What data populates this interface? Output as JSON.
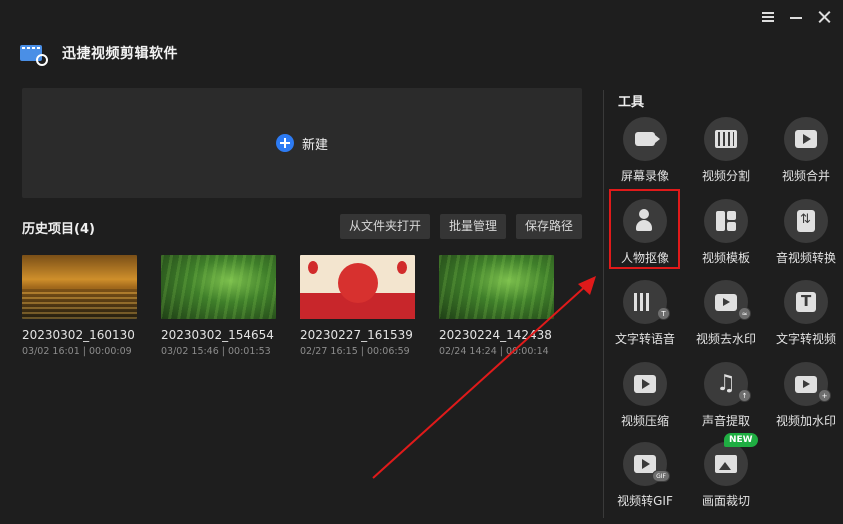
{
  "window": {
    "menu_icon": "hamburger-menu-icon",
    "minimize_icon": "minimize-icon",
    "close_icon": "close-icon"
  },
  "app": {
    "title": "迅捷视频剪辑软件",
    "logo_icon": "film-scissors-logo",
    "accent_color": "#2d7bf3"
  },
  "new_project": {
    "label": "新建",
    "icon": "plus-circle-icon"
  },
  "history": {
    "title": "历史项目(4)",
    "actions": [
      "从文件夹打开",
      "批量管理",
      "保存路径"
    ],
    "projects": [
      {
        "name": "20230302_160130",
        "meta": "03/02 16:01 | 00:00:09",
        "thumb": "sunset-sea"
      },
      {
        "name": "20230302_154654",
        "meta": "03/02 15:46 | 00:01:53",
        "thumb": "grass-field"
      },
      {
        "name": "20230227_161539",
        "meta": "02/27 16:15 | 00:06:59",
        "thumb": "red-festival"
      },
      {
        "name": "20230224_142438",
        "meta": "02/24 14:24 | 00:00:14",
        "thumb": "grass-field"
      }
    ]
  },
  "tools": {
    "title": "工具",
    "new_badge": "NEW",
    "highlight_color": "#e01a1a",
    "items": [
      {
        "label": "屏幕录像",
        "icon": "screen-record-icon"
      },
      {
        "label": "视频分割",
        "icon": "video-split-icon"
      },
      {
        "label": "视频合并",
        "icon": "video-merge-icon"
      },
      {
        "label": "人物抠像",
        "icon": "person-matting-icon"
      },
      {
        "label": "视频模板",
        "icon": "video-template-icon"
      },
      {
        "label": "音视频转换",
        "icon": "av-convert-icon"
      },
      {
        "label": "文字转语音",
        "icon": "text-to-speech-icon"
      },
      {
        "label": "视频去水印",
        "icon": "remove-watermark-icon"
      },
      {
        "label": "文字转视频",
        "icon": "text-to-video-icon"
      },
      {
        "label": "视频压缩",
        "icon": "video-compress-icon"
      },
      {
        "label": "声音提取",
        "icon": "audio-extract-icon"
      },
      {
        "label": "视频加水印",
        "icon": "add-watermark-icon"
      },
      {
        "label": "视频转GIF",
        "icon": "video-to-gif-icon"
      },
      {
        "label": "画面裁切",
        "icon": "crop-icon"
      }
    ]
  }
}
